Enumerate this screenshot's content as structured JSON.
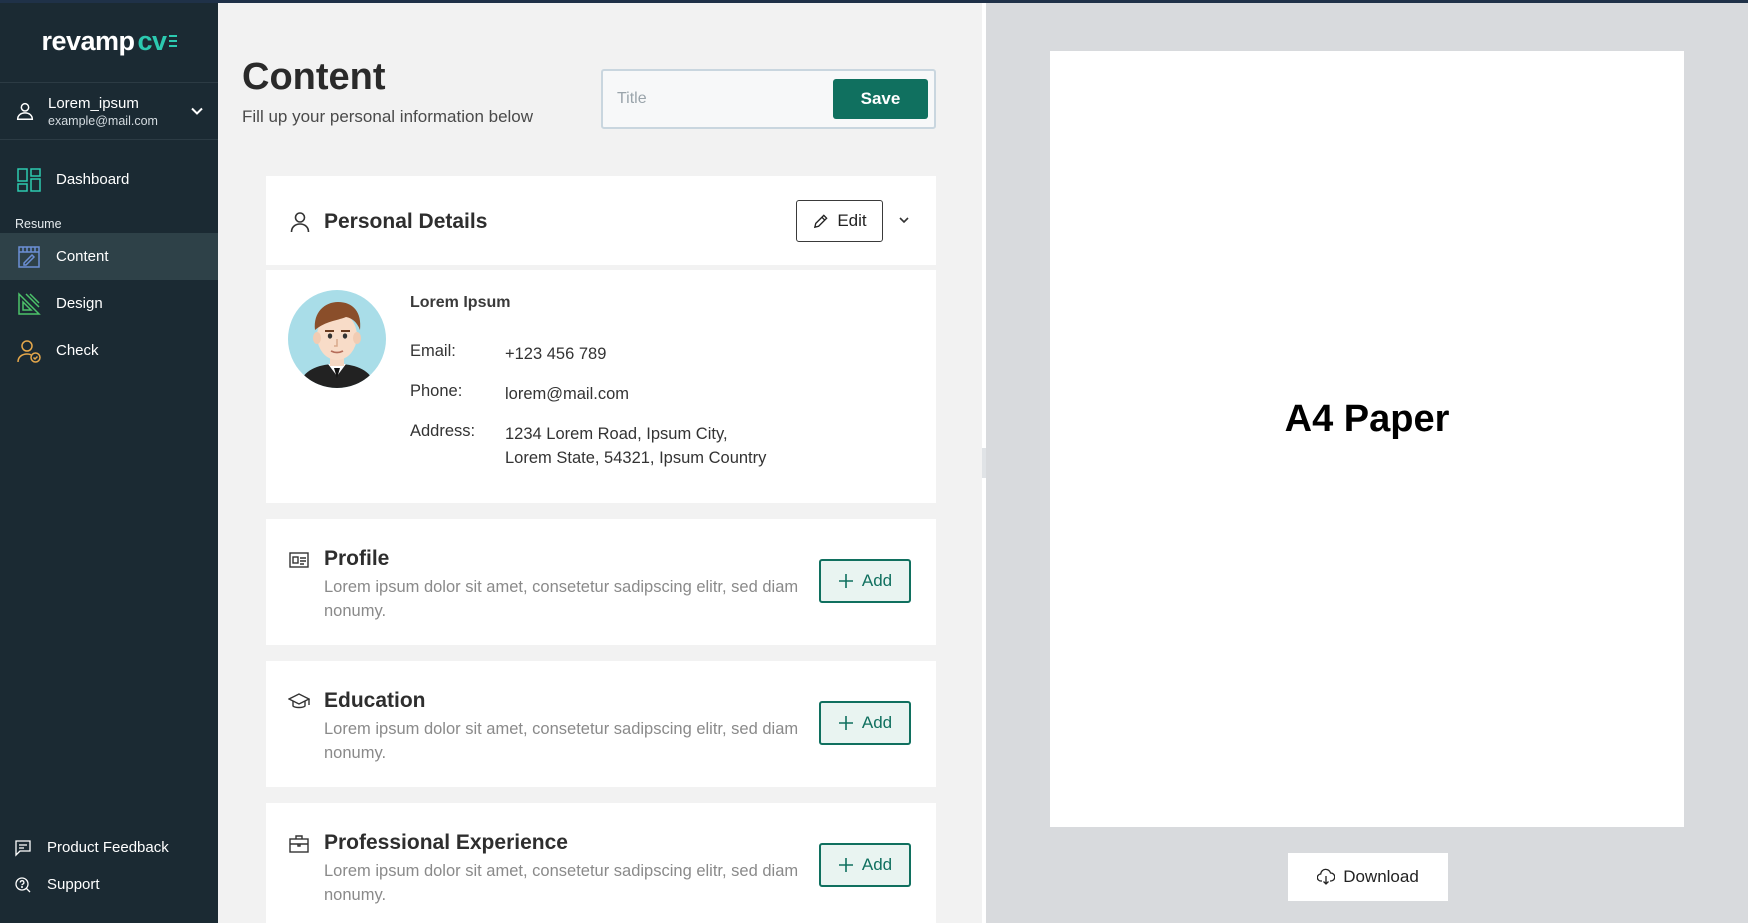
{
  "app": {
    "logo_main": "revamp",
    "logo_accent": "cv"
  },
  "user": {
    "name": "Lorem_ipsum",
    "email": "example@mail.com"
  },
  "sidebar": {
    "dashboard": "Dashboard",
    "section_label": "Resume",
    "items": [
      {
        "label": "Content",
        "icon": "content-icon",
        "active": true
      },
      {
        "label": "Design",
        "icon": "design-icon",
        "active": false
      },
      {
        "label": "Check",
        "icon": "check-user-icon",
        "active": false
      }
    ],
    "bottom": [
      {
        "label": "Product Feedback",
        "icon": "feedback-icon"
      },
      {
        "label": "Support",
        "icon": "support-icon"
      }
    ]
  },
  "header": {
    "title": "Content",
    "subtitle": "Fill up your personal information below",
    "title_placeholder": "Title",
    "save_label": "Save"
  },
  "personal": {
    "title": "Personal Details",
    "edit_label": "Edit",
    "name": "Lorem Ipsum",
    "email_label": "Email:",
    "email_value": "+123 456 789",
    "phone_label": "Phone:",
    "phone_value": "lorem@mail.com",
    "address_label": "Address:",
    "address_line1": "1234 Lorem Road, Ipsum City,",
    "address_line2": "Lorem State, 54321, Ipsum Country"
  },
  "sections": [
    {
      "title": "Profile",
      "desc": "Lorem ipsum dolor sit amet, consetetur sadipscing elitr, sed diam nonumy.",
      "add_label": "Add"
    },
    {
      "title": "Education",
      "desc": "Lorem ipsum dolor sit amet, consetetur sadipscing elitr, sed diam nonumy.",
      "add_label": "Add"
    },
    {
      "title": "Professional Experience",
      "desc": "Lorem ipsum dolor sit amet, consetetur sadipscing elitr, sed diam nonumy.",
      "add_label": "Add"
    }
  ],
  "preview": {
    "paper_label": "A4 Paper",
    "download_label": "Download"
  },
  "colors": {
    "sidebar_bg": "#1b2a33",
    "accent": "#10705f",
    "logo_accent": "#2cc9b0"
  }
}
